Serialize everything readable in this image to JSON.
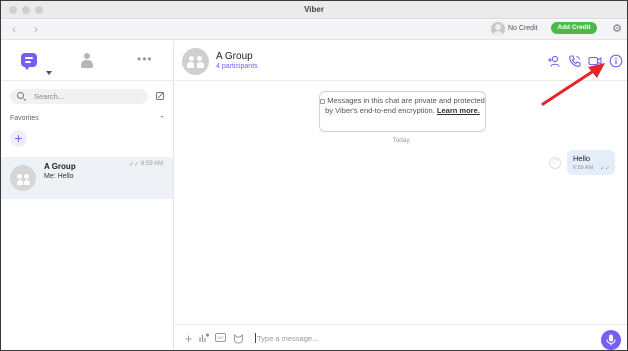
{
  "window": {
    "title": "Viber"
  },
  "toolbar": {
    "credit_label": "No Credit",
    "add_credit_label": "Add Credit"
  },
  "sidebar": {
    "search": {
      "placeholder": "Search..."
    },
    "favorites_label": "Favorites",
    "chats": [
      {
        "name": "A Group",
        "preview": "Me: Hello",
        "time": "6:59 AM"
      }
    ]
  },
  "conversation": {
    "title": "A Group",
    "subtitle": "4 participants",
    "privacy_notice": "Messages in this chat are private and protected by Viber's end-to-end encryption.",
    "privacy_link": "Learn more.",
    "day_label": "Today",
    "messages": [
      {
        "text": "Hello",
        "time": "6:59 AM",
        "direction": "outgoing"
      }
    ],
    "composer_placeholder": "Type a message..."
  },
  "colors": {
    "accent": "#7360f2",
    "credit_button": "#4eb84c",
    "arrow": "#e3262b"
  },
  "icons": [
    "back-arrow",
    "forward-arrow",
    "gear",
    "chat",
    "contacts",
    "more",
    "search",
    "compose",
    "add",
    "add-participant",
    "voice-call",
    "video-call",
    "info",
    "like",
    "plus",
    "audio-wave",
    "gif",
    "sticker",
    "microphone"
  ]
}
